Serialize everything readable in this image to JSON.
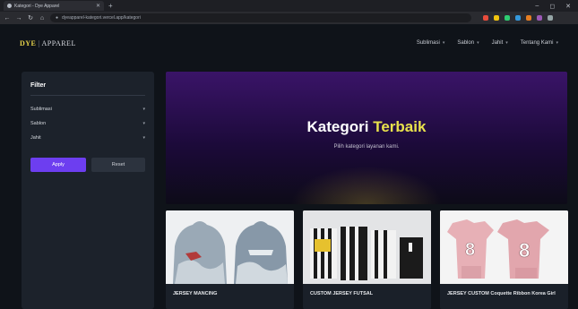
{
  "browser": {
    "tab_title": "Kategori - Dye Apparel",
    "new_tab": "+",
    "url": "dyeapparel-kategori.vercel.app/kategori",
    "win_min": "–",
    "win_max": "◻",
    "win_close": "✕"
  },
  "site": {
    "logo_mark": "DYE",
    "logo_sep": "|",
    "logo_name": "APPAREL",
    "menu": [
      {
        "label": "Sublimasi"
      },
      {
        "label": "Sablon"
      },
      {
        "label": "Jahit"
      },
      {
        "label": "Tentang Kami"
      }
    ]
  },
  "filter": {
    "title": "Filter",
    "items": [
      {
        "label": "Sublimasi"
      },
      {
        "label": "Sablon"
      },
      {
        "label": "Jahit"
      }
    ],
    "apply_label": "Apply",
    "reset_label": "Reset"
  },
  "hero": {
    "title_main": "Kategori",
    "title_accent": "Terbaik",
    "subtitle": "Pilih kategori layanan kami."
  },
  "cards": [
    {
      "label": "JERSEY MANCING"
    },
    {
      "label": "CUSTOM JERSEY FUTSAL"
    },
    {
      "label": "JERSEY CUSTOM Coquette Ribbon Korea Girl"
    }
  ],
  "colors": {
    "accent_purple": "#6d3ef0",
    "accent_yellow": "#e9e24c",
    "panel": "#1c222b"
  },
  "icons": [
    "favicon-icon",
    "close-icon",
    "back-icon",
    "forward-icon",
    "reload-icon",
    "home-icon",
    "chevron-down-icon",
    "hoodie-image",
    "jersey-image"
  ]
}
